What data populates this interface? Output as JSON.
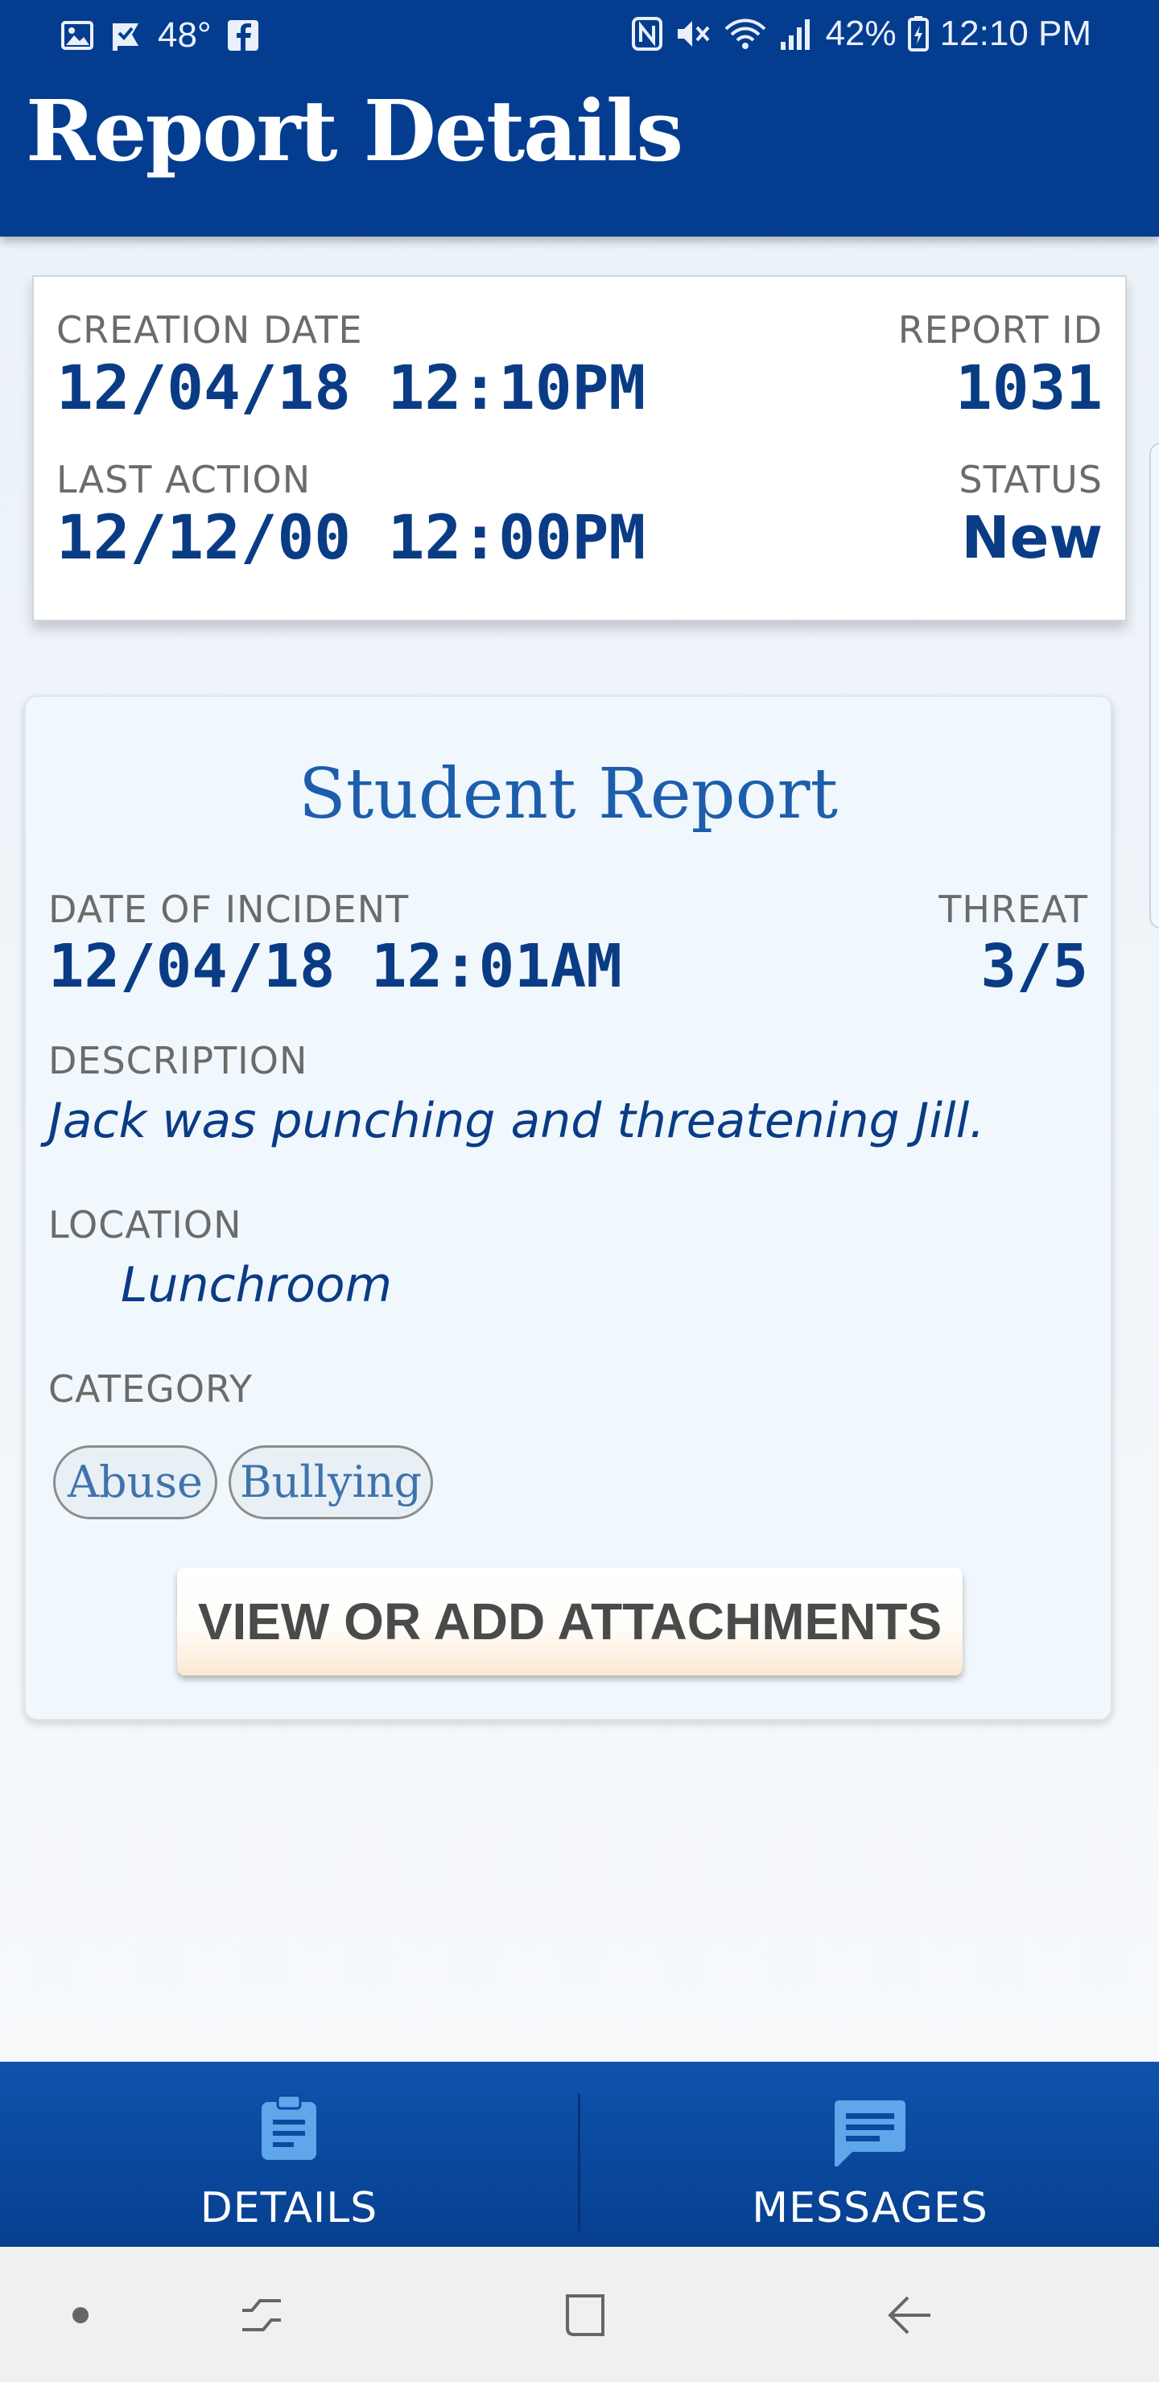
{
  "status_bar": {
    "temperature": "48°",
    "battery": "42%",
    "time": "12:10 PM"
  },
  "header": {
    "title": "Report Details"
  },
  "summary": {
    "creation_date_label": "CREATION DATE",
    "creation_date": "12/04/18 12:10PM",
    "report_id_label": "REPORT ID",
    "report_id": "1031",
    "last_action_label": "LAST ACTION",
    "last_action": "12/12/00 12:00PM",
    "status_label": "STATUS",
    "status": "New"
  },
  "report": {
    "title": "Student Report",
    "incident_date_label": "DATE OF INCIDENT",
    "incident_date": "12/04/18 12:01AM",
    "threat_label": "THREAT",
    "threat": "3/5",
    "description_label": "DESCRIPTION",
    "description": "Jack was punching and threatening Jill.",
    "location_label": "LOCATION",
    "location": "Lunchroom",
    "category_label": "CATEGORY",
    "categories": [
      "Abuse",
      "Bullying"
    ],
    "attachments_button": "VIEW OR ADD ATTACHMENTS"
  },
  "bottom_nav": {
    "items": [
      {
        "label": "DETAILS",
        "icon": "clipboard-icon"
      },
      {
        "label": "MESSAGES",
        "icon": "message-icon"
      }
    ]
  },
  "system_nav": {
    "icons": [
      "dot-icon",
      "recent-apps-icon",
      "home-icon",
      "back-icon"
    ]
  },
  "colors": {
    "header_bg": "#043d8f",
    "value_blue": "#0a3c86",
    "title_blue": "#1d5eac",
    "nav_bg": "#0e53ad",
    "nav_icon": "#5fa6ea"
  }
}
